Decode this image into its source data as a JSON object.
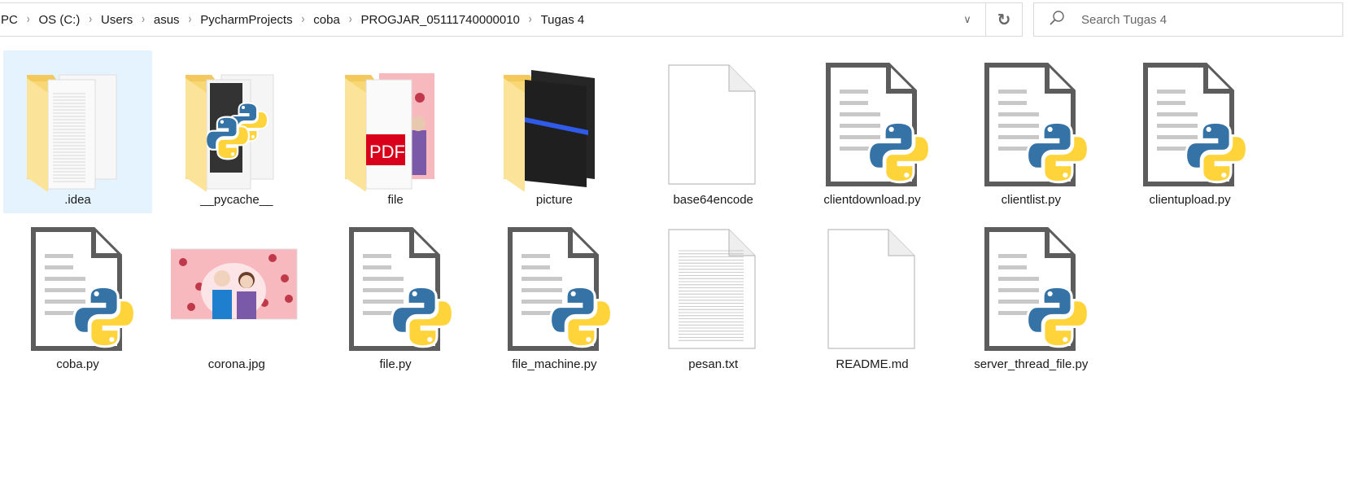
{
  "address_bar": {
    "breadcrumbs": [
      "PC",
      "OS (C:)",
      "Users",
      "asus",
      "PycharmProjects",
      "coba",
      "PROGJAR_05111740000010",
      "Tugas 4"
    ],
    "dropdown_icon": "chevron-down-icon",
    "refresh_icon": "refresh-icon"
  },
  "search": {
    "placeholder": "Search Tugas 4",
    "value": "",
    "icon": "search-icon"
  },
  "colors": {
    "selection": "#e5f3ff",
    "folder": "#f8d775",
    "python_blue": "#3572a5",
    "python_yellow": "#ffd43b"
  },
  "files": [
    {
      "name": ".idea",
      "type": "folder",
      "preview": "documents",
      "selected": true
    },
    {
      "name": "__pycache__",
      "type": "folder",
      "preview": "python"
    },
    {
      "name": "file",
      "type": "folder",
      "preview": "pdf"
    },
    {
      "name": "picture",
      "type": "folder",
      "preview": "dark"
    },
    {
      "name": "base64encode",
      "type": "blank"
    },
    {
      "name": "clientdownload.py",
      "type": "python"
    },
    {
      "name": "clientlist.py",
      "type": "python"
    },
    {
      "name": "clientupload.py",
      "type": "python"
    },
    {
      "name": "coba.py",
      "type": "python"
    },
    {
      "name": "corona.jpg",
      "type": "image"
    },
    {
      "name": "file.py",
      "type": "python"
    },
    {
      "name": "file_machine.py",
      "type": "python"
    },
    {
      "name": "pesan.txt",
      "type": "text"
    },
    {
      "name": "README.md",
      "type": "blank"
    },
    {
      "name": "server_thread_file.py",
      "type": "python"
    }
  ]
}
